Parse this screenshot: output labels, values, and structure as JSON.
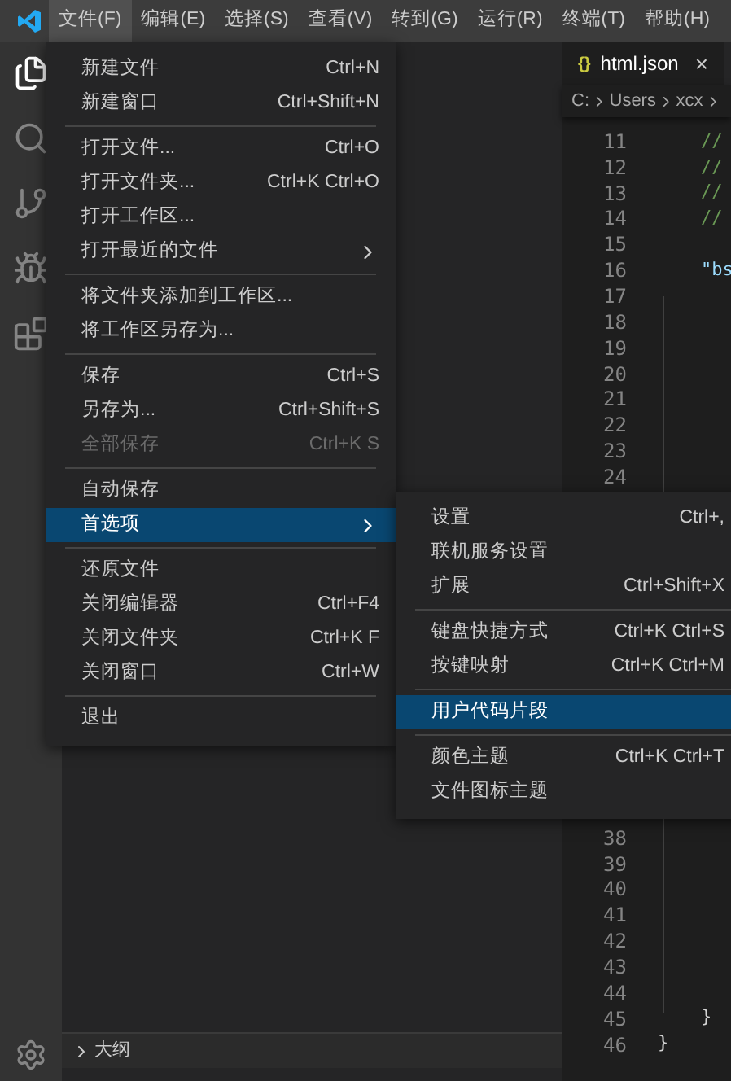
{
  "menubar": [
    {
      "label": "文件(F)",
      "selected": true
    },
    {
      "label": "编辑(E)",
      "selected": false
    },
    {
      "label": "选择(S)",
      "selected": false
    },
    {
      "label": "查看(V)",
      "selected": false
    },
    {
      "label": "转到(G)",
      "selected": false
    },
    {
      "label": "运行(R)",
      "selected": false
    },
    {
      "label": "终端(T)",
      "selected": false
    },
    {
      "label": "帮助(H)",
      "selected": false
    }
  ],
  "file_menu": [
    [
      {
        "label": "新建文件",
        "shortcut": "Ctrl+N",
        "disabled": false,
        "selected": false,
        "submenu": false
      },
      {
        "label": "新建窗口",
        "shortcut": "Ctrl+Shift+N",
        "disabled": false,
        "selected": false,
        "submenu": false
      }
    ],
    [
      {
        "label": "打开文件...",
        "shortcut": "Ctrl+O",
        "disabled": false,
        "selected": false,
        "submenu": false
      },
      {
        "label": "打开文件夹...",
        "shortcut": "Ctrl+K Ctrl+O",
        "disabled": false,
        "selected": false,
        "submenu": false
      },
      {
        "label": "打开工作区...",
        "disabled": false,
        "selected": false,
        "submenu": false
      },
      {
        "label": "打开最近的文件",
        "disabled": false,
        "selected": false,
        "submenu": true
      }
    ],
    [
      {
        "label": "将文件夹添加到工作区...",
        "disabled": false,
        "selected": false,
        "submenu": false
      },
      {
        "label": "将工作区另存为...",
        "disabled": false,
        "selected": false,
        "submenu": false
      }
    ],
    [
      {
        "label": "保存",
        "shortcut": "Ctrl+S",
        "disabled": false,
        "selected": false,
        "submenu": false
      },
      {
        "label": "另存为...",
        "shortcut": "Ctrl+Shift+S",
        "disabled": false,
        "selected": false,
        "submenu": false
      },
      {
        "label": "全部保存",
        "shortcut": "Ctrl+K S",
        "disabled": true,
        "selected": false,
        "submenu": false
      }
    ],
    [
      {
        "label": "自动保存",
        "disabled": false,
        "selected": false,
        "submenu": false
      },
      {
        "label": "首选项",
        "disabled": false,
        "selected": true,
        "submenu": true
      }
    ],
    [
      {
        "label": "还原文件",
        "disabled": false,
        "selected": false,
        "submenu": false
      },
      {
        "label": "关闭编辑器",
        "shortcut": "Ctrl+F4",
        "disabled": false,
        "selected": false,
        "submenu": false
      },
      {
        "label": "关闭文件夹",
        "shortcut": "Ctrl+K F",
        "disabled": false,
        "selected": false,
        "submenu": false
      },
      {
        "label": "关闭窗口",
        "shortcut": "Ctrl+W",
        "disabled": false,
        "selected": false,
        "submenu": false
      }
    ],
    [
      {
        "label": "退出",
        "disabled": false,
        "selected": false,
        "submenu": false
      }
    ]
  ],
  "preferences_menu": [
    [
      {
        "label": "设置",
        "shortcut": "Ctrl+,",
        "selected": false
      },
      {
        "label": "联机服务设置",
        "selected": false
      },
      {
        "label": "扩展",
        "shortcut": "Ctrl+Shift+X",
        "selected": false
      }
    ],
    [
      {
        "label": "键盘快捷方式",
        "shortcut": "Ctrl+K Ctrl+S",
        "selected": false
      },
      {
        "label": "按键映射",
        "shortcut": "Ctrl+K Ctrl+M",
        "selected": false
      }
    ],
    [
      {
        "label": "用户代码片段",
        "selected": true
      }
    ],
    [
      {
        "label": "颜色主题",
        "shortcut": "Ctrl+K Ctrl+T",
        "selected": false
      },
      {
        "label": "文件图标主题",
        "selected": false
      }
    ]
  ],
  "editor": {
    "tab": {
      "icon_text": "{}",
      "title": "html.json",
      "close": "×"
    },
    "breadcrumb": [
      "C:",
      "Users",
      "xcx"
    ],
    "lines": [
      {
        "number": "11",
        "code": "    //",
        "kind": "comment"
      },
      {
        "number": "12",
        "code": "    //",
        "kind": "comment"
      },
      {
        "number": "13",
        "code": "    //",
        "kind": "comment"
      },
      {
        "number": "14",
        "code": "    //",
        "kind": "comment"
      },
      {
        "number": "15"
      },
      {
        "number": "16",
        "code": "    \"bs",
        "kind": "key"
      },
      {
        "number": "17"
      },
      {
        "number": "18"
      },
      {
        "number": "19"
      },
      {
        "number": "20"
      },
      {
        "number": "21"
      },
      {
        "number": "22"
      },
      {
        "number": "23"
      },
      {
        "number": "24"
      },
      {
        "number": "38"
      },
      {
        "number": "39"
      },
      {
        "number": "40"
      },
      {
        "number": "41"
      },
      {
        "number": "42"
      },
      {
        "number": "43"
      },
      {
        "number": "44"
      },
      {
        "number": "45",
        "code": "    }",
        "kind": "punct"
      },
      {
        "number": "46",
        "code": "}",
        "kind": "punct"
      }
    ]
  },
  "sidebar": {
    "sections": [
      {
        "label": "大纲",
        "expanded": false
      }
    ]
  }
}
